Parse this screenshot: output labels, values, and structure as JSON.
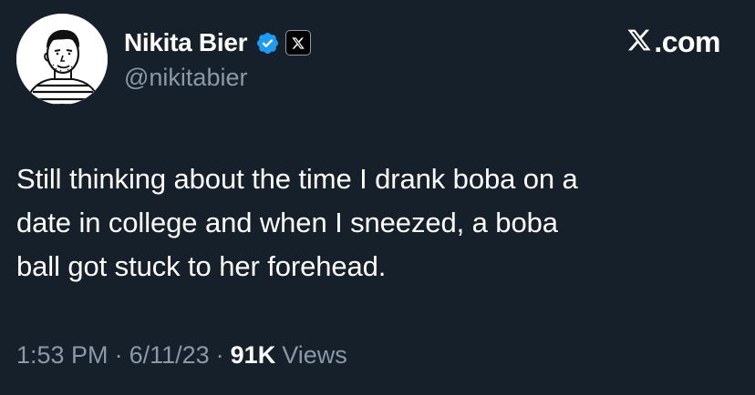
{
  "author": {
    "display_name": "Nikita Bier",
    "handle": "@nikitabier",
    "avatar_icon": "sketch-portrait-avatar",
    "verified_icon": "verified-badge-icon",
    "affiliation_icon": "x-logo-icon"
  },
  "brand": {
    "icon": "x-logo-icon",
    "text": ".com"
  },
  "tweet": {
    "text": "Still thinking about the time I drank boba on a\ndate in college and when I sneezed, a boba\nball got stuck to her forehead."
  },
  "meta": {
    "time": "1:53 PM",
    "separator": "·",
    "date": "6/11/23",
    "views_count": "91K",
    "views_label": "Views"
  },
  "colors": {
    "background": "#15202b",
    "text_primary": "#ffffff",
    "text_secondary": "#8b98a5",
    "verified_blue": "#1d9bf0"
  }
}
